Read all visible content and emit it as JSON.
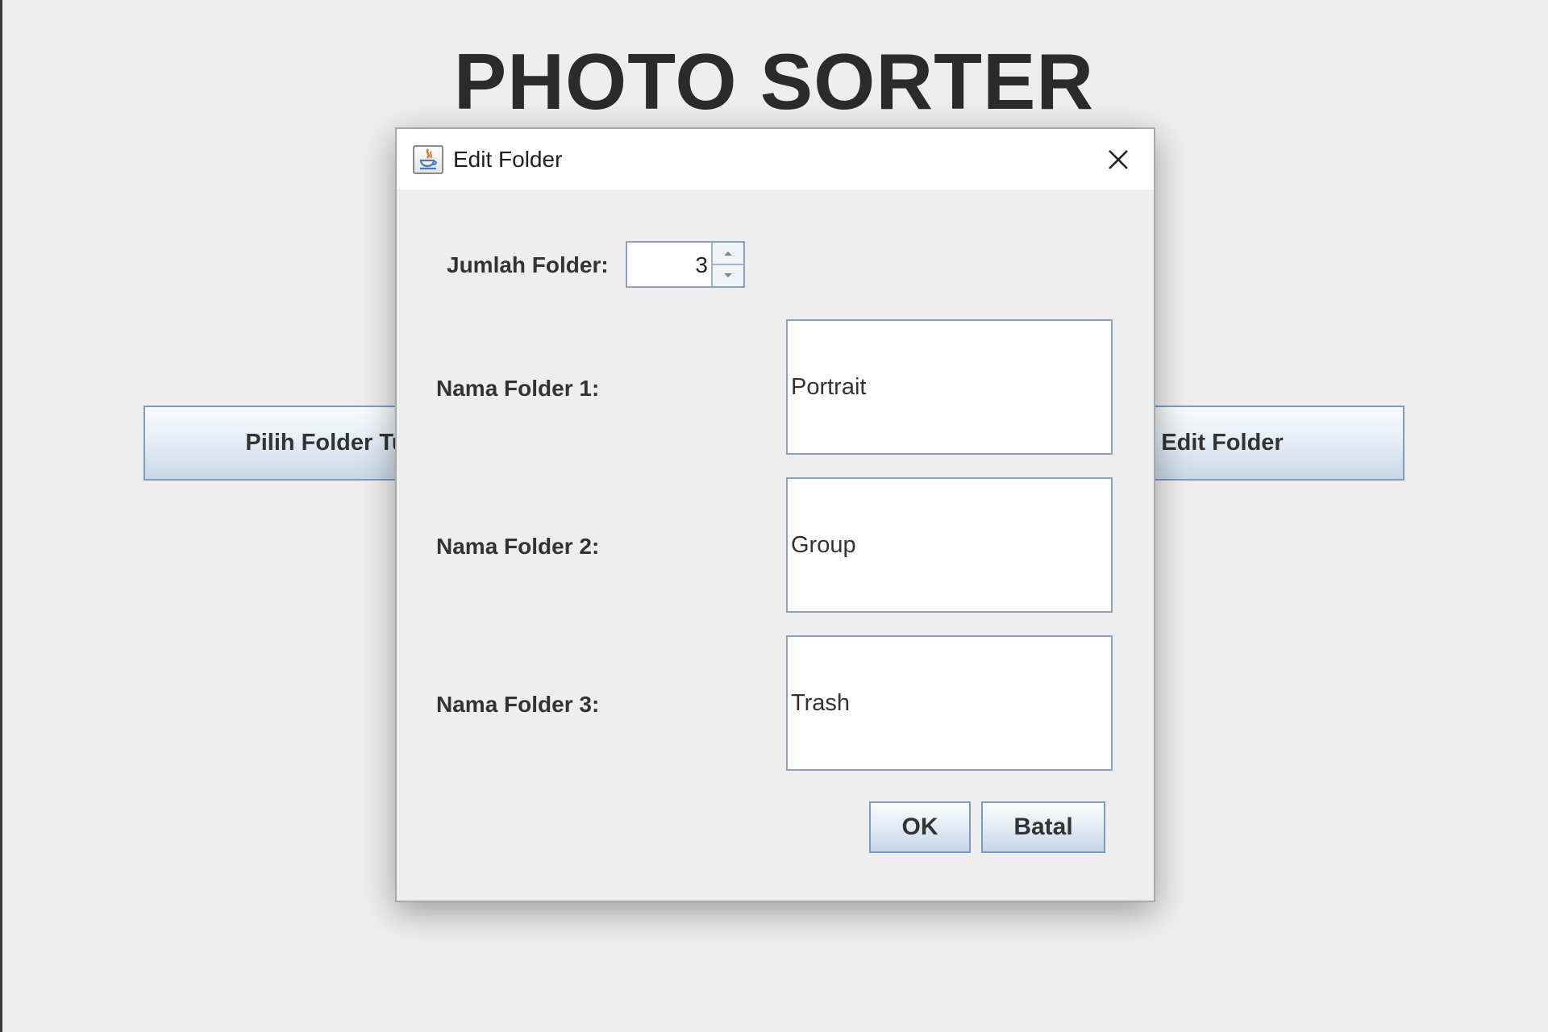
{
  "app": {
    "title": "PHOTO SORTER",
    "choose_folder_button": "Pilih Folder Tu",
    "edit_folder_button": "Edit Folder"
  },
  "dialog": {
    "title": "Edit Folder",
    "icon": "java-icon",
    "folder_count_label": "Jumlah Folder:",
    "folder_count_value": "3",
    "folders": [
      {
        "label": "Nama Folder 1:",
        "value": "Portrait"
      },
      {
        "label": "Nama Folder 2:",
        "value": "Group"
      },
      {
        "label": "Nama Folder 3:",
        "value": "Trash"
      }
    ],
    "ok_label": "OK",
    "cancel_label": "Batal"
  },
  "colors": {
    "background": "#eeeeee",
    "button_border": "#7a9cc4",
    "text": "#333333"
  }
}
